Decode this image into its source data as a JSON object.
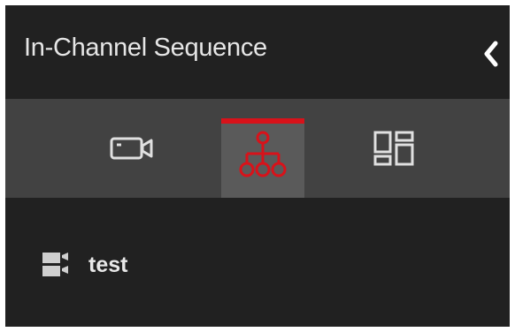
{
  "header": {
    "title": "In-Channel Sequence",
    "collapse_icon": "chevron-left-icon"
  },
  "tabs": [
    {
      "icon": "camera-icon",
      "active": false
    },
    {
      "icon": "sitemap-icon",
      "active": true
    },
    {
      "icon": "layout-grid-icon",
      "active": false
    }
  ],
  "list": {
    "items": [
      {
        "label": "test",
        "icon": "camera-group-icon"
      }
    ]
  },
  "colors": {
    "background": "#212121",
    "tabbar": "#424242",
    "active_tab": "#5a5a5a",
    "accent": "#d8121a",
    "text": "#e6e6e6"
  }
}
